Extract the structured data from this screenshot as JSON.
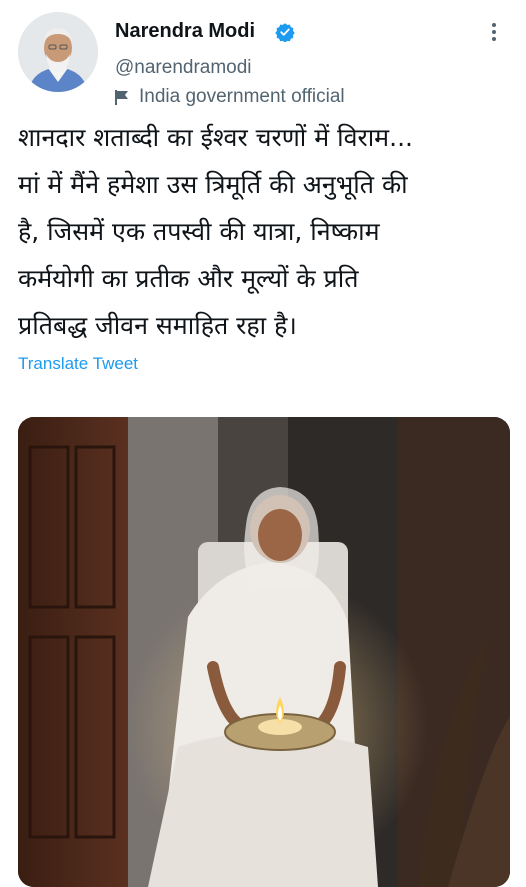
{
  "header": {
    "display_name": "Narendra Modi",
    "handle": "@narendramodi",
    "label": "India government official",
    "verified_icon": "verified-badge-icon",
    "label_icon": "flag-icon",
    "more_icon": "more-options-icon"
  },
  "tweet": {
    "lines": [
      "शानदार शताब्दी का ईश्वर चरणों में विराम...",
      "मां में मैंने हमेशा उस त्रिमूर्ति की अनुभूति की",
      "है, जिसमें एक तपस्वी की यात्रा, निष्काम",
      "कर्मयोगी का प्रतीक और मूल्यों के प्रति",
      "प्रतिबद्ध जीवन समाहित रहा है।"
    ],
    "translate_label": "Translate Tweet"
  },
  "colors": {
    "text": "#0f1419",
    "secondary": "#536471",
    "accent": "#1d9bf0"
  }
}
